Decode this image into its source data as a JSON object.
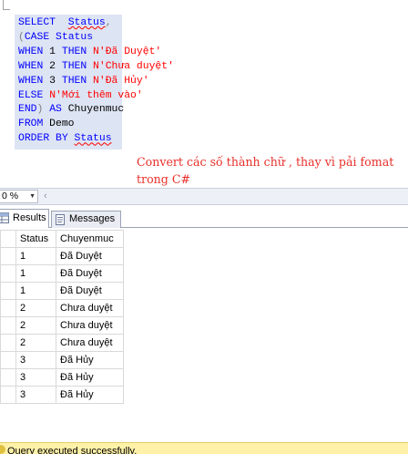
{
  "editor": {
    "truncated_line": "",
    "code_lines": [
      [
        {
          "t": "SELECT",
          "c": "kw"
        },
        {
          "t": "  "
        },
        {
          "t": "Status",
          "c": "kw squig"
        },
        {
          "t": ",",
          "c": "gray"
        }
      ],
      [
        {
          "t": "(",
          "c": "gray"
        },
        {
          "t": "CASE",
          "c": "kw"
        },
        {
          "t": " "
        },
        {
          "t": "Status",
          "c": "kw"
        }
      ],
      [
        {
          "t": "WHEN",
          "c": "kw"
        },
        {
          "t": " 1 "
        },
        {
          "t": "THEN",
          "c": "kw"
        },
        {
          "t": " "
        },
        {
          "t": "N'Đã Duyệt'",
          "c": "str"
        }
      ],
      [
        {
          "t": "WHEN",
          "c": "kw"
        },
        {
          "t": " 2 "
        },
        {
          "t": "THEN",
          "c": "kw"
        },
        {
          "t": " "
        },
        {
          "t": "N'Chưa duyệt'",
          "c": "str"
        }
      ],
      [
        {
          "t": "WHEN",
          "c": "kw"
        },
        {
          "t": " 3 "
        },
        {
          "t": "THEN",
          "c": "kw"
        },
        {
          "t": " "
        },
        {
          "t": "N'Đã Hủy'",
          "c": "str"
        }
      ],
      [
        {
          "t": "ELSE",
          "c": "kw"
        },
        {
          "t": " "
        },
        {
          "t": "N'Mới thêm vào'",
          "c": "str"
        }
      ],
      [
        {
          "t": "END",
          "c": "kw"
        },
        {
          "t": ")",
          "c": "gray"
        },
        {
          "t": " "
        },
        {
          "t": "AS",
          "c": "kw"
        },
        {
          "t": " Chuyenmuc"
        }
      ],
      [
        {
          "t": "FROM",
          "c": "kw"
        },
        {
          "t": " Demo"
        }
      ],
      [
        {
          "t": "ORDER BY",
          "c": "kw"
        },
        {
          "t": " "
        },
        {
          "t": "Status",
          "c": "kw squig"
        }
      ]
    ],
    "annotation": "Convert các số thành chữ , thay vì pải fomat trong C#"
  },
  "zoom": {
    "value": "0 %"
  },
  "tabs": {
    "results_label": "Results",
    "messages_label": "Messages"
  },
  "grid": {
    "columns": [
      "Status",
      "Chuyenmuc"
    ],
    "rows": [
      [
        "1",
        "Đã Duyệt"
      ],
      [
        "1",
        "Đã Duyệt"
      ],
      [
        "1",
        "Đã Duyệt"
      ],
      [
        "2",
        "Chưa duyệt"
      ],
      [
        "2",
        "Chưa duyệt"
      ],
      [
        "2",
        "Chưa duyệt"
      ],
      [
        "3",
        "Đã Hủy"
      ],
      [
        "3",
        "Đã Hủy"
      ],
      [
        "3",
        "Đã Hủy"
      ]
    ]
  },
  "status_bar": {
    "text": "Query executed successfully."
  },
  "colors": {
    "keyword": "#0000ff",
    "string": "#ff0000",
    "annotation": "#e8302a",
    "status_bg": "#fff2a8"
  }
}
